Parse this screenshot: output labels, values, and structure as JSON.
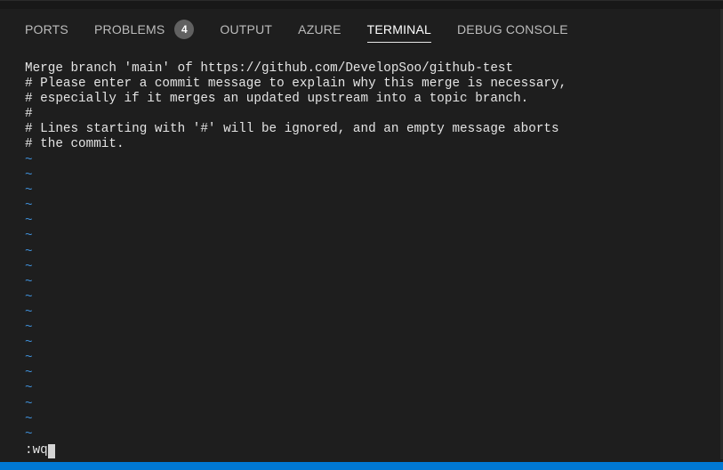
{
  "tabs": [
    {
      "label": "PORTS",
      "active": false
    },
    {
      "label": "PROBLEMS",
      "active": false,
      "badge": "4"
    },
    {
      "label": "OUTPUT",
      "active": false
    },
    {
      "label": "AZURE",
      "active": false
    },
    {
      "label": "TERMINAL",
      "active": true
    },
    {
      "label": "DEBUG CONSOLE",
      "active": false
    }
  ],
  "terminal": {
    "lines": [
      "Merge branch 'main' of https://github.com/DevelopSoo/github-test",
      "# Please enter a commit message to explain why this merge is necessary,",
      "# especially if it merges an updated upstream into a topic branch.",
      "#",
      "# Lines starting with '#' will be ignored, and an empty message aborts",
      "# the commit."
    ],
    "tilde_lines": [
      "~",
      "~",
      "~",
      "~",
      "~",
      "~",
      "~",
      "~",
      "~",
      "~",
      "~",
      "~",
      "~",
      "~",
      "~",
      "~",
      "~",
      "~",
      "~"
    ],
    "command": ":wq"
  },
  "colors": {
    "background": "#1e1e1e",
    "tilde": "#3f8fd8",
    "statusbar": "#0078d4"
  }
}
